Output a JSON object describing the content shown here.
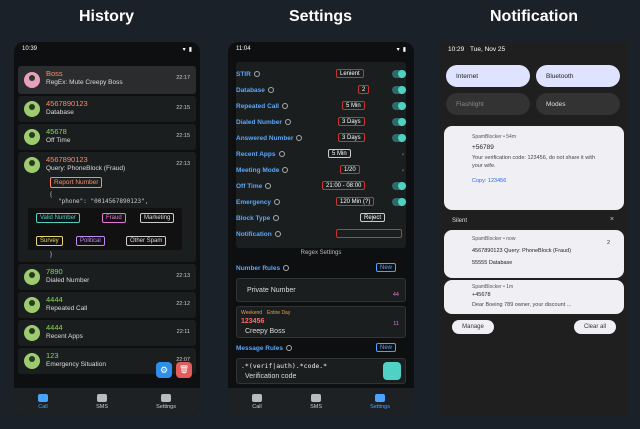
{
  "titles": {
    "history": "History",
    "settings": "Settings",
    "notification": "Notification"
  },
  "history": {
    "status_time": "10:39",
    "items": [
      {
        "number": "Boss",
        "sub": "RegEx: Mute Creepy Boss",
        "time": "22:17",
        "color": "#ff8a65"
      },
      {
        "number": "4567890123",
        "sub": "Database",
        "time": "22:15",
        "color": "#8cd35a"
      },
      {
        "number": "45678",
        "sub": "Off Time",
        "time": "22:15",
        "color": "#8cd35a"
      },
      {
        "number": "4567890123",
        "sub": "Query: PhoneBlock (Fraud)",
        "time": "22:13",
        "color": "#ff8a65"
      },
      {
        "number": "7890",
        "sub": "Dialed Number",
        "time": "22:13",
        "color": "#8cd35a"
      },
      {
        "number": "4444",
        "sub": "Repeated Call",
        "time": "22:12",
        "color": "#8cd35a"
      },
      {
        "number": "4444",
        "sub": "Recent Apps",
        "time": "22:11",
        "color": "#8cd35a"
      },
      {
        "number": "123",
        "sub": "Emergency Situation",
        "time": "22:07",
        "color": "#8cd35a"
      }
    ],
    "report_button": "Report Number",
    "json_line": "\"phone\": \"0014567890123\",",
    "brace_open": "{",
    "brace_close": "}",
    "tags": [
      "Valid Number",
      "Fraud",
      "Marketing",
      "Survey",
      "Political",
      "Other Spam"
    ],
    "nav": {
      "call": "Call",
      "sms": "SMS",
      "settings": "Settings",
      "badge": "8"
    }
  },
  "settings": {
    "status_time": "11:04",
    "rows": [
      {
        "label": "STIR",
        "value": "Lenient"
      },
      {
        "label": "Database",
        "value": "2"
      },
      {
        "label": "Repeated Call",
        "value": "5 Min"
      },
      {
        "label": "Dialed Number",
        "value": "3 Days"
      },
      {
        "label": "Answered Number",
        "value": "3 Days"
      },
      {
        "label": "Recent Apps",
        "value": "5 Min"
      },
      {
        "label": "Meeting Mode",
        "value": "1/20"
      },
      {
        "label": "Off Time",
        "value": "21:00 - 08:00"
      },
      {
        "label": "Emergency",
        "value": "120 Min (?)"
      },
      {
        "label": "Block Type",
        "value": "Reject"
      },
      {
        "label": "Notification",
        "value": ""
      }
    ],
    "regex_header": "Regex Settings",
    "number_rules": "Number Rules",
    "message_rules": "Message Rules",
    "new_label": "New",
    "rule1": {
      "name": "Private Number",
      "count": "44"
    },
    "rule2": {
      "tag": "Weekend",
      "tag2": "Entire Day",
      "pattern": "123456",
      "name": "Creepy Boss",
      "count": "11"
    },
    "msg_rule": {
      "pattern": ".*(verif|auth).*code.*",
      "name": "Verification code"
    },
    "nav": {
      "call": "Call",
      "sms": "SMS",
      "settings": "Settings",
      "badge": "8"
    }
  },
  "notification": {
    "status_time": "10:29",
    "status_date": "Tue, Nov 25",
    "tiles": [
      "Internet",
      "Bluetooth",
      "Flashlight",
      "Modes"
    ],
    "card1": {
      "app": "SpamBlocker • 54m",
      "number": "+56789",
      "body": "Your verification code: 123456, do not share it with your wife.",
      "copy": "Copy: 123456"
    },
    "silent": "Silent",
    "card2": {
      "app": "SpamBlocker • now",
      "line1": "4567890123 Query: PhoneBlock (Fraud)",
      "line2": "55555 Database",
      "count": "2"
    },
    "card3": {
      "app": "SpamBlocker • 1m",
      "number": "+45678",
      "body": "Dear Boeing 789 owner, your discount ..."
    },
    "manage": "Manage",
    "clear": "Clear all"
  }
}
